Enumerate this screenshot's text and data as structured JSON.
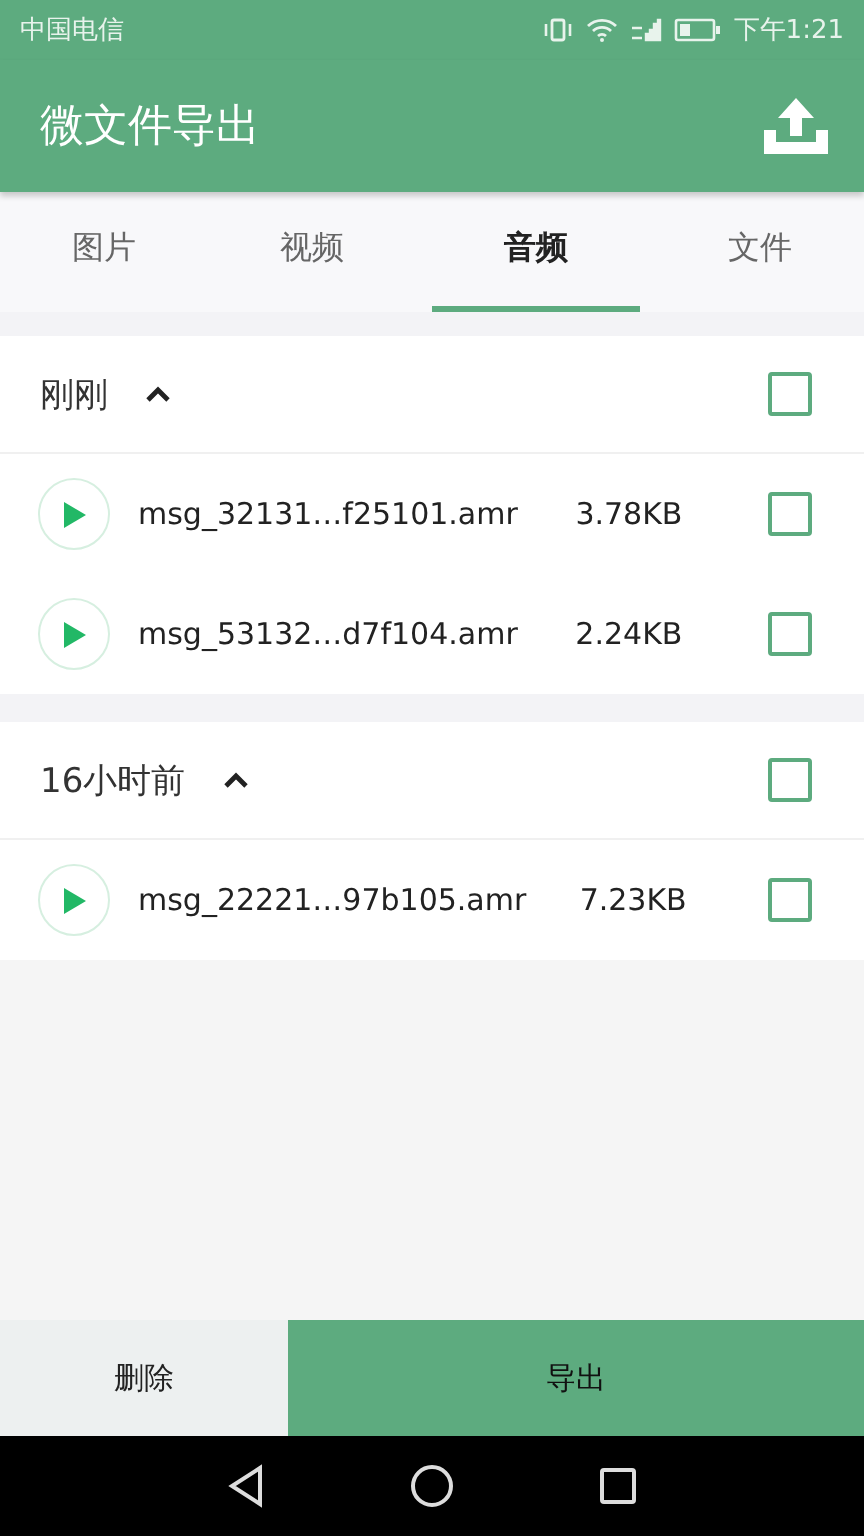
{
  "status_bar": {
    "carrier": "中国电信",
    "time": "下午1:21"
  },
  "app_bar": {
    "title": "微文件导出"
  },
  "tabs": [
    {
      "label": "图片",
      "selected": false
    },
    {
      "label": "视频",
      "selected": false
    },
    {
      "label": "音频",
      "selected": true
    },
    {
      "label": "文件",
      "selected": false
    }
  ],
  "groups": [
    {
      "title": "刚刚",
      "expanded": true,
      "checked": false,
      "files": [
        {
          "name": "msg_32131…f25101.amr",
          "size": "3.78KB",
          "checked": false
        },
        {
          "name": "msg_53132…d7f104.amr",
          "size": "2.24KB",
          "checked": false
        }
      ]
    },
    {
      "title": "16小时前",
      "expanded": true,
      "checked": false,
      "files": [
        {
          "name": "msg_22221…97b105.amr",
          "size": "7.23KB",
          "checked": false
        }
      ]
    }
  ],
  "bottom_bar": {
    "delete_button": "删除",
    "export_button": "导出"
  }
}
